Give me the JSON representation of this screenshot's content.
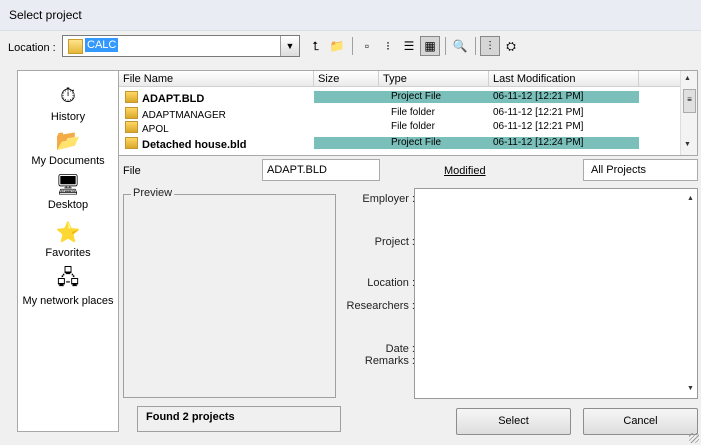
{
  "title": "Select project",
  "location": {
    "label": "Location :",
    "value": "CALC"
  },
  "toolbar": {
    "buttons": [
      {
        "icon": "up-folder-icon",
        "glyph": "⮤"
      },
      {
        "icon": "new-folder-icon",
        "glyph": "📁"
      },
      {
        "icon": "small-icons-view-icon",
        "glyph": "▫"
      },
      {
        "icon": "list-view-icon",
        "glyph": "⁝"
      },
      {
        "icon": "details-view-icon",
        "glyph": "☰"
      },
      {
        "icon": "thumbnails-view-icon",
        "glyph": "▦"
      },
      {
        "icon": "preview-icon",
        "glyph": "🔍"
      },
      {
        "icon": "tree-view-icon",
        "glyph": "⫶"
      },
      {
        "icon": "network-icon",
        "glyph": "⛭"
      }
    ]
  },
  "places": [
    {
      "label": "History",
      "icon": "history-icon",
      "glyph": "⏱"
    },
    {
      "label": "My Documents",
      "icon": "my-documents-icon",
      "glyph": "📂"
    },
    {
      "label": "Desktop",
      "icon": "desktop-icon",
      "glyph": "🖥"
    },
    {
      "label": "Favorites",
      "icon": "favorites-icon",
      "glyph": "⭐"
    },
    {
      "label": "My network places",
      "icon": "network-places-icon",
      "glyph": "🖧"
    }
  ],
  "columns": {
    "name": "File Name",
    "size": "Size",
    "type": "Type",
    "modified": "Last Modification"
  },
  "files": [
    {
      "name": "ADAPT.BLD",
      "size": "",
      "type": "Project File",
      "modified": "06-11-12 [12:21 PM]",
      "highlight": true,
      "bold": true
    },
    {
      "name": "ADAPTMANAGER",
      "size": "",
      "type": "File folder",
      "modified": "06-11-12 [12:21 PM]",
      "highlight": false,
      "bold": false
    },
    {
      "name": "APOL",
      "size": "",
      "type": "File folder",
      "modified": "06-11-12 [12:21 PM]",
      "highlight": false,
      "bold": false
    },
    {
      "name": "Detached house.bld",
      "size": "",
      "type": "Project File",
      "modified": "06-11-12 [12:24 PM]",
      "highlight": true,
      "bold": true
    }
  ],
  "file_field": {
    "label": "File",
    "value": "ADAPT.BLD"
  },
  "modified_label": "Modified",
  "filter": {
    "value": "All Projects"
  },
  "preview_label": "Preview",
  "fields": {
    "employer": "Employer :",
    "project": "Project :",
    "location": "Location :",
    "researchers": "Researchers :",
    "date": "Date :",
    "remarks": "Remarks :"
  },
  "status": "Found 2 projects",
  "buttons": {
    "select": "Select",
    "cancel": "Cancel"
  },
  "colors": {
    "highlight": "#7bbfba",
    "selection": "#3399ff"
  }
}
